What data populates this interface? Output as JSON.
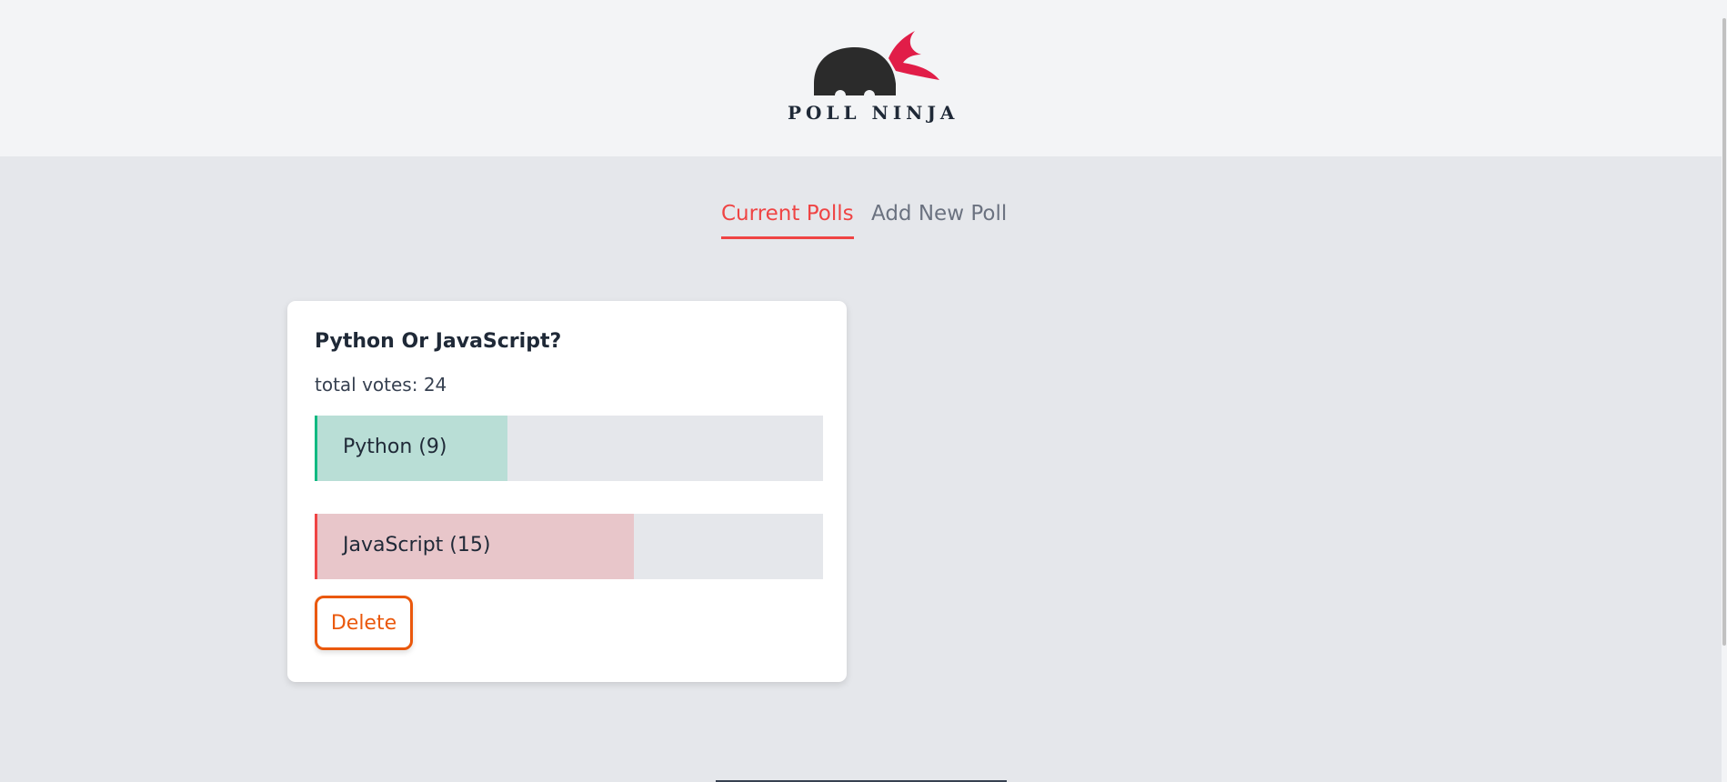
{
  "header": {
    "logo_text": "POLL NINJA",
    "logo_icon": "ninja-head-icon"
  },
  "tabs": [
    {
      "label": "Current Polls",
      "active": true
    },
    {
      "label": "Add New Poll",
      "active": false
    }
  ],
  "poll": {
    "question": "Python Or JavaScript?",
    "total_votes_text": "total votes: 24",
    "total_votes": 24,
    "answers": [
      {
        "label": "Python (9)",
        "votes": 9,
        "share": 0.375,
        "color": "#10b981"
      },
      {
        "label": "JavaScript (15)",
        "votes": 15,
        "share": 0.625,
        "color": "#ef4444"
      }
    ],
    "delete_label": "Delete"
  },
  "colors": {
    "accent": "#ef4444",
    "delete": "#ea580c",
    "page_bg": "#e5e7eb",
    "header_bg": "#f3f4f6"
  }
}
